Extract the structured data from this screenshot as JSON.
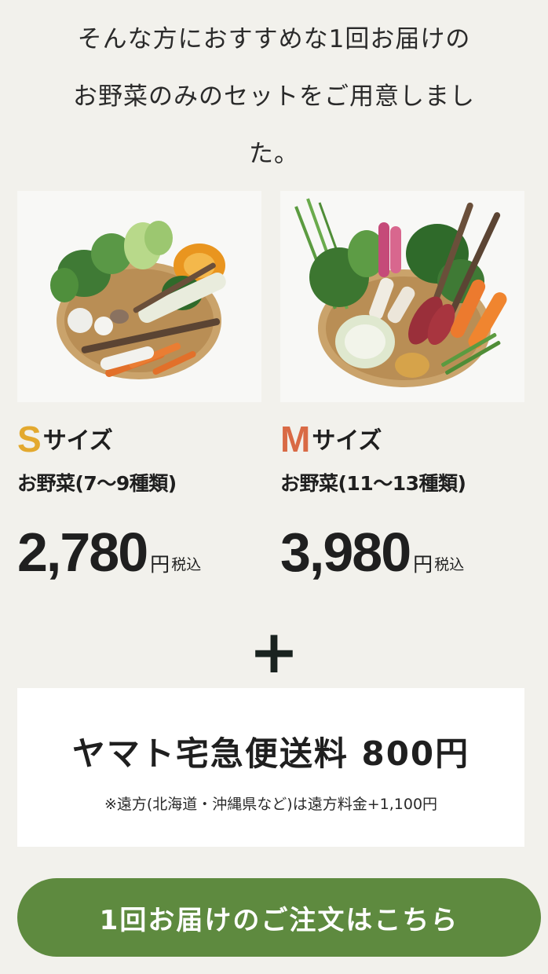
{
  "intro": {
    "line1": "そんな方におすすめな1回お届けの",
    "line2": "お野菜のみのセットをご用意しまし",
    "line3": "た。"
  },
  "plans": [
    {
      "size_letter": "S",
      "size_word": "サイズ",
      "letter_color": "#e3a92f",
      "count": "お野菜(7〜9種類)",
      "price": "2,780",
      "yen": "円",
      "tax": "税込",
      "image_alt": "vegetable-basket-s"
    },
    {
      "size_letter": "M",
      "size_word": "サイズ",
      "letter_color": "#d96a45",
      "count": "お野菜(11〜13種類)",
      "price": "3,980",
      "yen": "円",
      "tax": "税込",
      "image_alt": "vegetable-basket-m"
    }
  ],
  "plus": "+",
  "shipping": {
    "title": "ヤマト宅急便送料 800円",
    "note": "※遠方(北海道・沖縄県など)は遠方料金+1,100円"
  },
  "cta": {
    "label": "1回お届けのご注文はこちら",
    "color": "#5e8a3f"
  }
}
